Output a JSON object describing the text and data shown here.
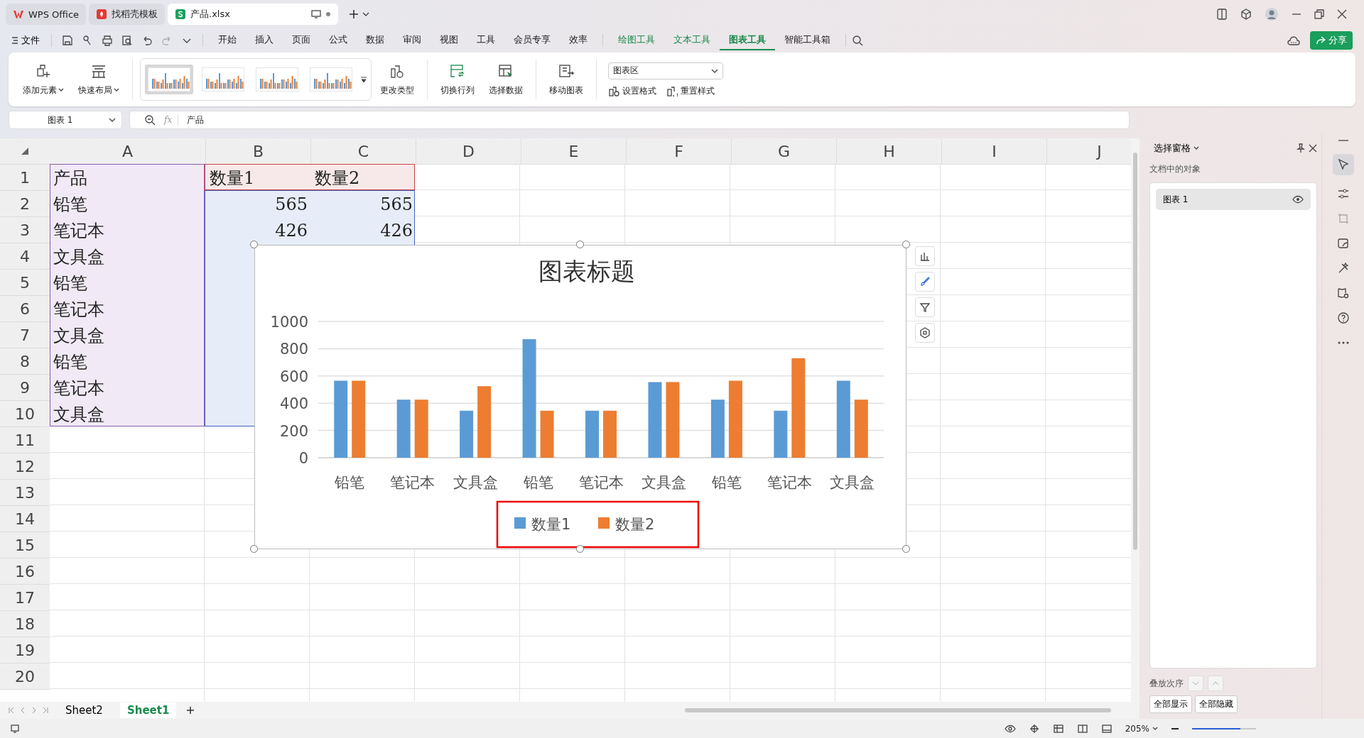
{
  "tabs": [
    {
      "label": "WPS Office",
      "kind": "wps",
      "selected": false
    },
    {
      "label": "找稻壳模板",
      "kind": "docer",
      "selected": false
    },
    {
      "label": "产品.xlsx",
      "kind": "sheet",
      "selected": true
    }
  ],
  "menu": {
    "file": "文件",
    "items": [
      {
        "label": "开始",
        "kind": "standard",
        "selected": false
      },
      {
        "label": "插入",
        "kind": "standard",
        "selected": false
      },
      {
        "label": "页面",
        "kind": "standard",
        "selected": false
      },
      {
        "label": "公式",
        "kind": "standard",
        "selected": false
      },
      {
        "label": "数据",
        "kind": "standard",
        "selected": false
      },
      {
        "label": "审阅",
        "kind": "standard",
        "selected": false
      },
      {
        "label": "视图",
        "kind": "standard",
        "selected": false
      },
      {
        "label": "工具",
        "kind": "standard",
        "selected": false
      },
      {
        "label": "会员专享",
        "kind": "standard",
        "selected": false
      },
      {
        "label": "效率",
        "kind": "standard",
        "selected": false
      },
      {
        "label": "绘图工具",
        "kind": "context",
        "selected": false
      },
      {
        "label": "文本工具",
        "kind": "context",
        "selected": false
      },
      {
        "label": "图表工具",
        "kind": "context",
        "selected": true
      },
      {
        "label": "智能工具箱",
        "kind": "standard",
        "selected": false
      }
    ],
    "share": "分享"
  },
  "ribbon": {
    "left_buttons": [
      {
        "label": "添加元素",
        "kind": "add"
      },
      {
        "label": "快速布局",
        "kind": "layout"
      }
    ],
    "style_presets": [
      {
        "selected": true
      },
      {
        "selected": false
      },
      {
        "selected": false
      },
      {
        "selected": false
      }
    ],
    "right_buttons": [
      {
        "label": "更改类型",
        "kind": "type"
      },
      {
        "label": "切换行列",
        "kind": "switch"
      },
      {
        "label": "选择数据",
        "kind": "data"
      },
      {
        "label": "移动图表",
        "kind": "move"
      }
    ],
    "element_select": "图表区",
    "small_buttons": [
      {
        "label": "设置格式",
        "kind": "format"
      },
      {
        "label": "重置样式",
        "kind": "reset"
      }
    ]
  },
  "formula_bar": {
    "name_box": "图表 1",
    "fx": "fx",
    "formula": "产品"
  },
  "sheet": {
    "columns": [
      "A",
      "B",
      "C",
      "D",
      "E",
      "F",
      "G",
      "H",
      "I",
      "J"
    ],
    "rows": [
      {
        "number": "1",
        "cells": [
          "产品",
          "数量1",
          "数量2"
        ]
      },
      {
        "number": "2",
        "cells": [
          "铅笔",
          "565",
          "565"
        ]
      },
      {
        "number": "3",
        "cells": [
          "笔记本",
          "426",
          "426"
        ]
      },
      {
        "number": "4",
        "cells": [
          "文具盒"
        ]
      },
      {
        "number": "5",
        "cells": [
          "铅笔"
        ]
      },
      {
        "number": "6",
        "cells": [
          "笔记本"
        ]
      },
      {
        "number": "7",
        "cells": [
          "文具盒"
        ]
      },
      {
        "number": "8",
        "cells": [
          "铅笔"
        ]
      },
      {
        "number": "9",
        "cells": [
          "笔记本"
        ]
      },
      {
        "number": "10",
        "cells": [
          "文具盒"
        ]
      },
      {
        "number": "11"
      },
      {
        "number": "12"
      },
      {
        "number": "13"
      },
      {
        "number": "14"
      },
      {
        "number": "15"
      },
      {
        "number": "16"
      },
      {
        "number": "17"
      },
      {
        "number": "18"
      },
      {
        "number": "19"
      },
      {
        "number": "20"
      }
    ],
    "chart": {
      "chart_data": {
        "type": "bar",
        "title": "图表标题",
        "categories": [
          "铅笔",
          "笔记本",
          "文具盒",
          "铅笔",
          "笔记本",
          "文具盒",
          "铅笔",
          "笔记本",
          "文具盒"
        ],
        "series": [
          {
            "name": "数量1",
            "color": "#5b9bd5",
            "values": [
              565,
              426,
              345,
              870,
              345,
              555,
              426,
              345,
              565
            ]
          },
          {
            "name": "数量2",
            "color": "#ed7d31",
            "values": [
              565,
              426,
              525,
              345,
              345,
              555,
              565,
              730,
              426
            ]
          }
        ],
        "ylim": [
          0,
          1000
        ],
        "yticks": [
          0,
          200,
          400,
          600,
          800,
          1000
        ],
        "grid": true,
        "legend": true
      }
    }
  },
  "sheet_tabs": [
    {
      "label": "Sheet2",
      "selected": false
    },
    {
      "label": "Sheet1",
      "selected": true
    }
  ],
  "selection_pane": {
    "title": "选择窗格",
    "subtitle": "文档中的对象",
    "objects": [
      {
        "name": "图表 1",
        "visible": true
      }
    ],
    "order_label": "叠放次序",
    "show_all": "全部显示",
    "hide_all": "全部隐藏"
  },
  "status_bar": {
    "zoom": "205%",
    "zoom_slider": {
      "level": 0.75
    }
  }
}
